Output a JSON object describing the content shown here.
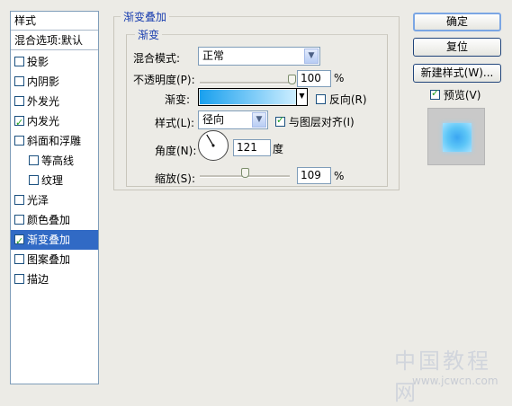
{
  "style_list": {
    "header": "样式",
    "blend_options": "混合选项:默认",
    "items": [
      {
        "label": "投影",
        "checked": false,
        "indent": false,
        "selected": false
      },
      {
        "label": "内阴影",
        "checked": false,
        "indent": false,
        "selected": false
      },
      {
        "label": "外发光",
        "checked": false,
        "indent": false,
        "selected": false
      },
      {
        "label": "内发光",
        "checked": true,
        "indent": false,
        "selected": false
      },
      {
        "label": "斜面和浮雕",
        "checked": false,
        "indent": false,
        "selected": false
      },
      {
        "label": "等高线",
        "checked": false,
        "indent": true,
        "selected": false
      },
      {
        "label": "纹理",
        "checked": false,
        "indent": true,
        "selected": false
      },
      {
        "label": "光泽",
        "checked": false,
        "indent": false,
        "selected": false
      },
      {
        "label": "颜色叠加",
        "checked": false,
        "indent": false,
        "selected": false
      },
      {
        "label": "渐变叠加",
        "checked": true,
        "indent": false,
        "selected": true
      },
      {
        "label": "图案叠加",
        "checked": false,
        "indent": false,
        "selected": false
      },
      {
        "label": "描边",
        "checked": false,
        "indent": false,
        "selected": false
      }
    ]
  },
  "panel": {
    "title": "渐变叠加",
    "section": "渐变",
    "blend_mode_label": "混合模式:",
    "blend_mode_value": "正常",
    "opacity_label": "不透明度(P):",
    "opacity_value": "100",
    "opacity_fraction": 1.0,
    "percent": "%",
    "gradient_label": "渐变:",
    "gradient_colors": [
      "#19a0ee",
      "#cdeeff"
    ],
    "reverse_label": "反向(R)",
    "reverse_checked": false,
    "style_label": "样式(L):",
    "style_value": "径向",
    "align_label": "与图层对齐(I)",
    "align_checked": true,
    "angle_label": "角度(N):",
    "angle_value": "121",
    "angle_unit": "度",
    "scale_label": "缩放(S):",
    "scale_value": "109",
    "scale_fraction": 0.5
  },
  "buttons": {
    "ok": "确定",
    "reset": "复位",
    "new_style": "新建样式(W)...",
    "preview": "预览(V)",
    "preview_checked": true
  },
  "watermark": {
    "text": "中国教程网",
    "url": "www.jcwcn.com"
  }
}
